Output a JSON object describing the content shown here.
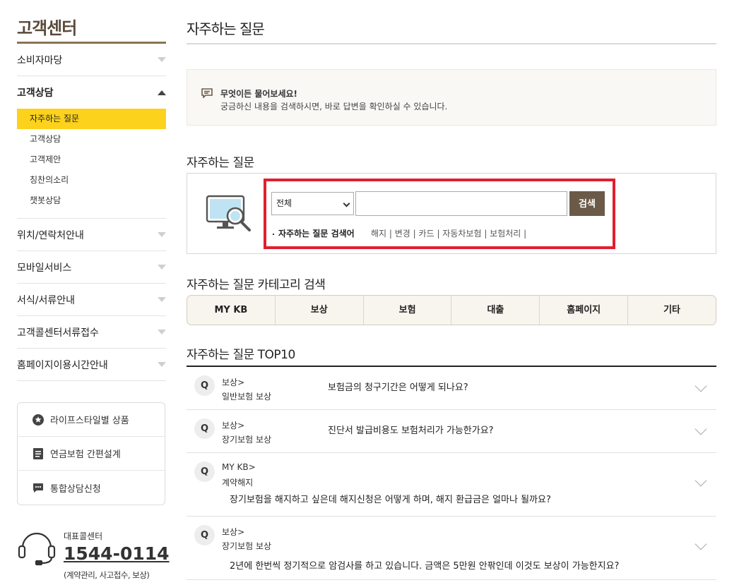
{
  "sidebar": {
    "title": "고객센터",
    "menu": [
      {
        "label": "소비자마당"
      },
      {
        "label": "고객상담"
      },
      {
        "label": "위치/연락처안내"
      },
      {
        "label": "모바일서비스"
      },
      {
        "label": "서식/서류안내"
      },
      {
        "label": "고객콜센터서류접수"
      },
      {
        "label": "홈페이지이용시간안내"
      }
    ],
    "submenu": [
      {
        "label": "자주하는 질문"
      },
      {
        "label": "고객상담"
      },
      {
        "label": "고객제안"
      },
      {
        "label": "칭찬의소리"
      },
      {
        "label": "챗봇상담"
      }
    ],
    "quick_links": [
      {
        "label": "라이프스타일별 상품",
        "icon": "star-circle-icon"
      },
      {
        "label": "연금보험 간편설계",
        "icon": "document-icon"
      },
      {
        "label": "통합상담신청",
        "icon": "chat-icon"
      }
    ],
    "call_center": {
      "label": "대표콜센터",
      "number": "1544-0114",
      "note": "(계약관리, 사고접수, 보상)"
    }
  },
  "main": {
    "page_title": "자주하는 질문",
    "info": {
      "title": "무엇이든 물어보세요!",
      "text": "궁금하신 내용을 검색하시면, 바로 답변을 확인하실 수 있습니다."
    },
    "search_section_title": "자주하는 질문",
    "search": {
      "select_value": "전체",
      "input_value": "",
      "button_label": "검색",
      "keyword_label": "자주하는 질문 검색어",
      "keywords": [
        "해지",
        "변경",
        "카드",
        "자동차보험",
        "보험처리"
      ]
    },
    "category_section_title": "자주하는 질문 카테고리 검색",
    "categories": [
      "MY KB",
      "보상",
      "보험",
      "대출",
      "홈페이지",
      "기타"
    ],
    "top10_title": "자주하는 질문 TOP10",
    "faqs": [
      {
        "badge": "Q",
        "cat1": "보상>",
        "cat2": "일반보험 보상",
        "question": "보험금의 청구기간은 어떻게 되나요?"
      },
      {
        "badge": "Q",
        "cat1": "보상>",
        "cat2": "장기보험 보상",
        "question": "진단서 발급비용도 보험처리가 가능한가요?"
      },
      {
        "badge": "Q",
        "cat1": "MY KB>",
        "cat2": "계약해지",
        "question": "장기보험을 해지하고 싶은데 해지신청은 어떻게 하며, 해지 환급금은 얼마나 될까요?"
      },
      {
        "badge": "Q",
        "cat1": "보상>",
        "cat2": "장기보험 보상",
        "question": "2년에 한번씩 정기적으로 암검사를 하고 있습니다. 금액은 5만원 안팎인데 이것도 보상이 가능한지요?"
      }
    ]
  },
  "colors": {
    "active_menu": "#fcd21c",
    "search_button": "#6b5a48",
    "highlight_border": "#e0202e",
    "title_underline": "#8a7553"
  }
}
